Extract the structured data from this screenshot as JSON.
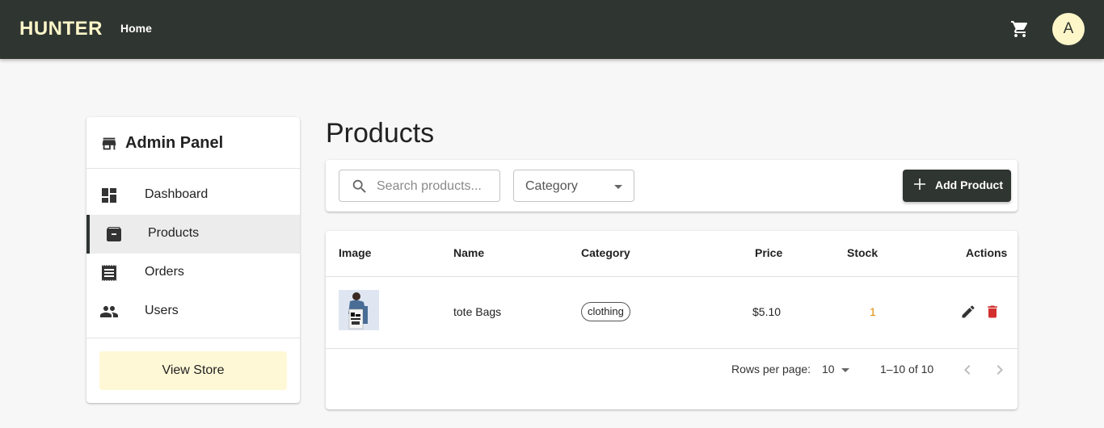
{
  "header": {
    "brand": "HUNTER",
    "nav_home": "Home",
    "cart_icon": "shopping-cart-icon",
    "avatar_letter": "A",
    "bar_color": "#2f3530",
    "brand_color": "#fdf6c9"
  },
  "sidebar": {
    "title": "Admin Panel",
    "title_icon": "store-icon",
    "items": [
      {
        "label": "Dashboard",
        "icon": "dashboard-icon",
        "active": false
      },
      {
        "label": "Products",
        "icon": "archive-box-icon",
        "active": true
      },
      {
        "label": "Orders",
        "icon": "receipt-icon",
        "active": false
      },
      {
        "label": "Users",
        "icon": "people-icon",
        "active": false
      }
    ],
    "view_store_label": "View Store"
  },
  "main": {
    "title": "Products",
    "search_placeholder": "Search products...",
    "category_select": "Category",
    "add_button_label": "Add Product"
  },
  "table": {
    "columns": [
      "Image",
      "Name",
      "Category",
      "Price",
      "Stock",
      "Actions"
    ],
    "rows": [
      {
        "name": "tote Bags",
        "category": "clothing",
        "price": "$5.10",
        "stock": "1"
      }
    ],
    "rows_per_page_label": "Rows per page:",
    "rows_per_page": "10",
    "range": "1–10 of 10"
  },
  "colors": {
    "accent": "#2f3530",
    "stock_low": "#e08a00",
    "delete": "#d32f2f",
    "view_store_bg": "#fff8d6"
  }
}
